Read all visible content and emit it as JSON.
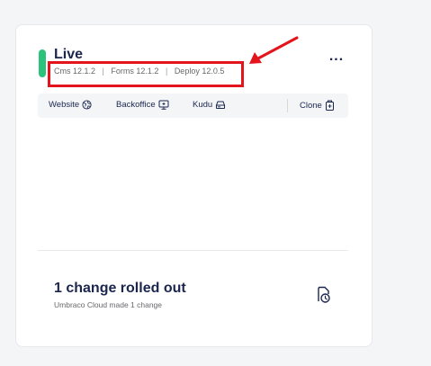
{
  "environment": {
    "name": "Live",
    "status_color": "#2bc37b",
    "more_label": "...",
    "versions": {
      "cms": "Cms 12.1.2",
      "forms": "Forms 12.1.2",
      "deploy": "Deploy 12.0.5",
      "separator": "|"
    }
  },
  "actions": {
    "website": {
      "label": "Website",
      "icon": "globe-icon"
    },
    "backoffice": {
      "label": "Backoffice",
      "icon": "monitor-icon"
    },
    "kudu": {
      "label": "Kudu",
      "icon": "kudu-icon"
    },
    "clone": {
      "label": "Clone",
      "icon": "clone-icon"
    }
  },
  "changes": {
    "title": "1 change rolled out",
    "subtitle": "Umbraco Cloud made 1 change",
    "icon": "history-icon"
  },
  "annotation": {
    "color": "#e3141b"
  }
}
